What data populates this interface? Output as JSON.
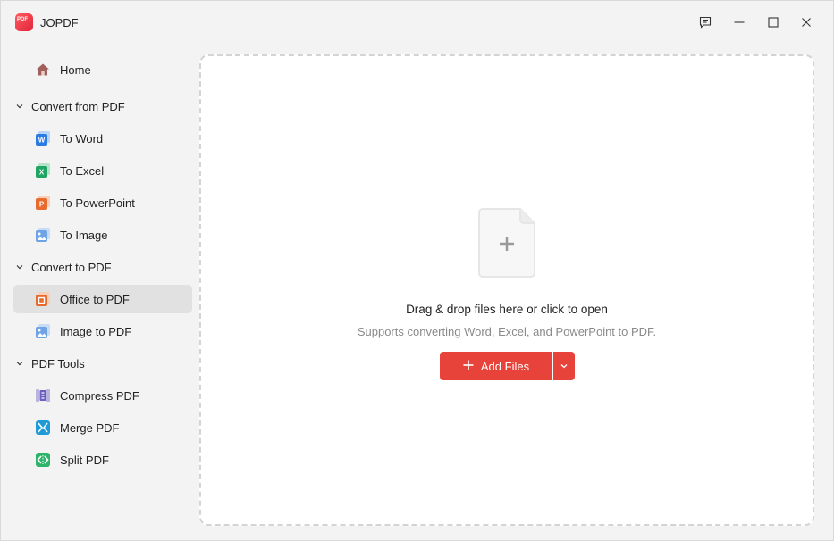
{
  "app": {
    "title": "JOPDF",
    "logo_text": "PDF",
    "brand_color": "#e8433a"
  },
  "window_controls": [
    "feedback-icon",
    "minimize-icon",
    "maximize-icon",
    "close-icon"
  ],
  "sidebar": {
    "home": {
      "label": "Home",
      "icon": "home-icon"
    },
    "sections": [
      {
        "label": "Convert from PDF",
        "items": [
          {
            "label": "To Word",
            "icon": "word-icon"
          },
          {
            "label": "To Excel",
            "icon": "excel-icon"
          },
          {
            "label": "To PowerPoint",
            "icon": "powerpoint-icon"
          },
          {
            "label": "To Image",
            "icon": "image-icon"
          }
        ]
      },
      {
        "label": "Convert to PDF",
        "items": [
          {
            "label": "Office to PDF",
            "icon": "office-icon",
            "active": true
          },
          {
            "label": "Image to PDF",
            "icon": "image-icon"
          }
        ]
      },
      {
        "label": "PDF Tools",
        "items": [
          {
            "label": "Compress PDF",
            "icon": "compress-icon"
          },
          {
            "label": "Merge PDF",
            "icon": "merge-icon"
          },
          {
            "label": "Split PDF",
            "icon": "split-icon"
          }
        ]
      }
    ]
  },
  "dropzone": {
    "title": "Drag & drop files here or click to open",
    "subtitle": "Supports converting Word, Excel, and PowerPoint to PDF.",
    "add_button_label": "Add Files"
  }
}
